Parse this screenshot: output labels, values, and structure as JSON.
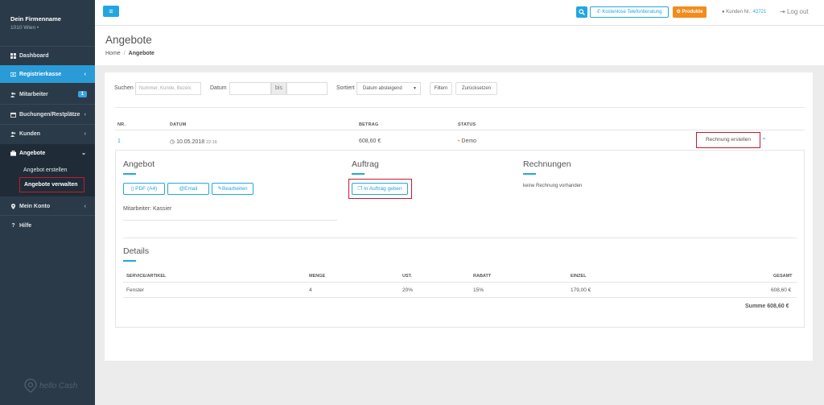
{
  "sidebar": {
    "brand_name": "Dein Firmenname",
    "brand_city": "1010 Wien",
    "brand_city_dot": "•",
    "items": [
      {
        "label": "Dashboard",
        "icon": "dashboard-icon"
      },
      {
        "label": "Registrierkasse",
        "icon": "cash-register-icon"
      },
      {
        "label": "Mitarbeiter",
        "icon": "users-icon",
        "badge": "1"
      },
      {
        "label": "Buchungen/Restplätze",
        "icon": "calendar-icon"
      },
      {
        "label": "Kunden",
        "icon": "customers-icon"
      },
      {
        "label": "Angebote",
        "icon": "briefcase-icon"
      },
      {
        "label": "Mein Konto",
        "icon": "location-icon"
      },
      {
        "label": "Hilfe",
        "icon": "question-icon"
      }
    ],
    "sub_items": [
      "Angebot erstellen",
      "Angebote verwalten"
    ],
    "logo_text": "hello Cash"
  },
  "topbar": {
    "phone_label": "Kostenlose Telefonberatung",
    "products_label": "Produkte",
    "customer_prefix": "Kunden Nr.:",
    "customer_number": "42721",
    "logout_label": "Log out",
    "accent": "#23a6e0",
    "orange": "#f28c1c"
  },
  "header": {
    "title": "Angebote",
    "breadcrumb_home": "Home",
    "breadcrumb_sep": "/",
    "breadcrumb_current": "Angebote"
  },
  "filters": {
    "search_label": "Suchen",
    "search_placeholder": "Nummer, Kunde, Bezeic",
    "date_label": "Datum",
    "bis_label": "bis",
    "sort_label": "Sortiert",
    "sort_value": "Datum absteigend",
    "filter_button": "Filtern",
    "reset_button": "Zurücksetzen"
  },
  "table": {
    "headers": [
      "NR.",
      "DATUM",
      "BETRAG",
      "STATUS"
    ],
    "row": {
      "nr": "1",
      "date": "10.05.2018",
      "time": "22:16",
      "amount": "608,60 €",
      "status": "Demo",
      "action": "Rechnung erstellen"
    }
  },
  "detail": {
    "angebot_title": "Angebot",
    "pdf_button": "PDF (A4)",
    "email_button": "Email",
    "edit_button": "Bearbeiten",
    "employee_text": "Mitarbeiter: Kassier",
    "auftrag_title": "Auftrag",
    "auftrag_button": "In Auftrag geben",
    "rechnungen_title": "Rechnungen",
    "rechnungen_text": "keine Rechnung vorhanden",
    "details_title": "Details",
    "items_headers": [
      "SERVICE/ARTIKEL",
      "MENGE",
      "UST.",
      "RABATT",
      "EINZEL",
      "GESAMT"
    ],
    "items": [
      {
        "article": "Fenster",
        "qty": "4",
        "ust": "20%",
        "rabatt": "15%",
        "einzel": "179,00 €",
        "gesamt": "608,60 €"
      }
    ],
    "summe": "Summe 608,60 €"
  }
}
